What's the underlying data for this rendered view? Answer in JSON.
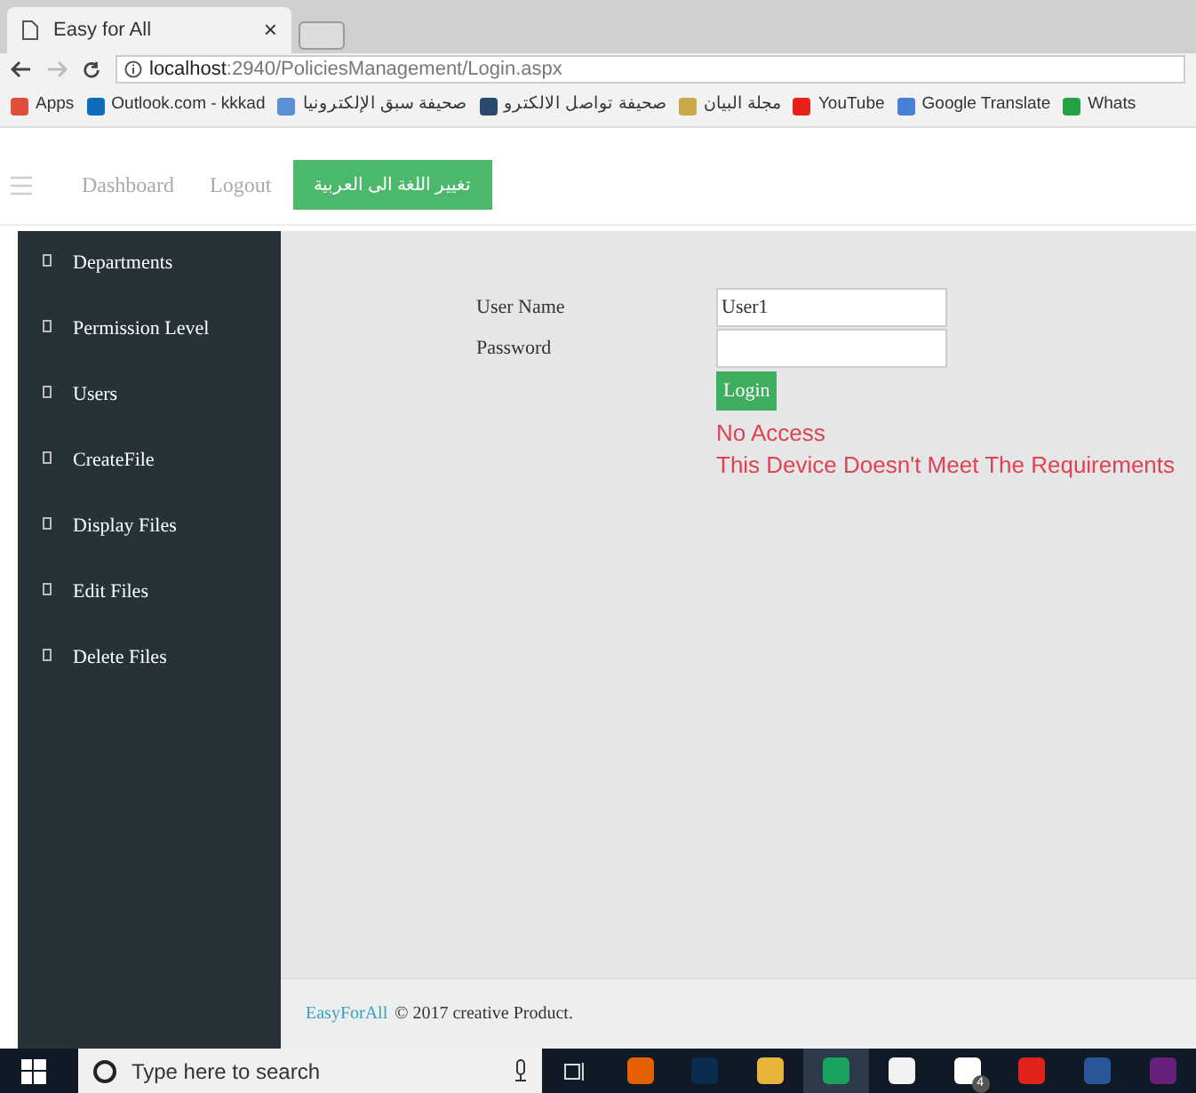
{
  "browser": {
    "tab": {
      "title": "Easy for All",
      "close": "×"
    },
    "address": {
      "host": "localhost",
      "path": ":2940/PoliciesManagement/Login.aspx"
    },
    "bookmarks": [
      {
        "label": "Apps",
        "color": "#e04f3c"
      },
      {
        "label": "Outlook.com - kkkad",
        "color": "#0f6cbd"
      },
      {
        "label": "صحيفة سبق الإلكترونيا",
        "color": "#5b8fd6"
      },
      {
        "label": "صحيفة تواصل الالكترو",
        "color": "#2a4a6e"
      },
      {
        "label": "مجلة البيان",
        "color": "#c9a84a"
      },
      {
        "label": "YouTube",
        "color": "#e62117"
      },
      {
        "label": "Google Translate",
        "color": "#4a7fd8"
      },
      {
        "label": "Whats",
        "color": "#25a244"
      }
    ]
  },
  "navbar": {
    "links": [
      "Dashboard",
      "Logout"
    ],
    "language_button": "تغيير اللغة الى العربية"
  },
  "sidebar": {
    "items": [
      "Departments",
      "Permission Level",
      "Users",
      "CreateFile",
      "Display Files",
      "Edit Files",
      "Delete Files"
    ]
  },
  "login": {
    "username_label": "User Name",
    "username_value": "User1",
    "password_label": "Password",
    "button": "Login",
    "errors": [
      "No Access",
      "This Device Doesn't Meet The Requirements"
    ]
  },
  "footer": {
    "brand": "EasyForAll",
    "text": "© 2017 creative Product."
  },
  "taskbar": {
    "search_placeholder": "Type here to search",
    "apps": [
      {
        "color": "#e66000",
        "selected": false
      },
      {
        "color": "#0b2b4f",
        "selected": false
      },
      {
        "color": "#e8b43a",
        "selected": false
      },
      {
        "color": "#1aa260",
        "selected": true
      },
      {
        "color": "#f2f2f2",
        "selected": false
      },
      {
        "color": "#ffffff",
        "badge": "4",
        "selected": false
      },
      {
        "color": "#e0241b",
        "selected": false
      },
      {
        "color": "#2b579a",
        "selected": false
      },
      {
        "color": "#68217a",
        "selected": false
      }
    ]
  }
}
